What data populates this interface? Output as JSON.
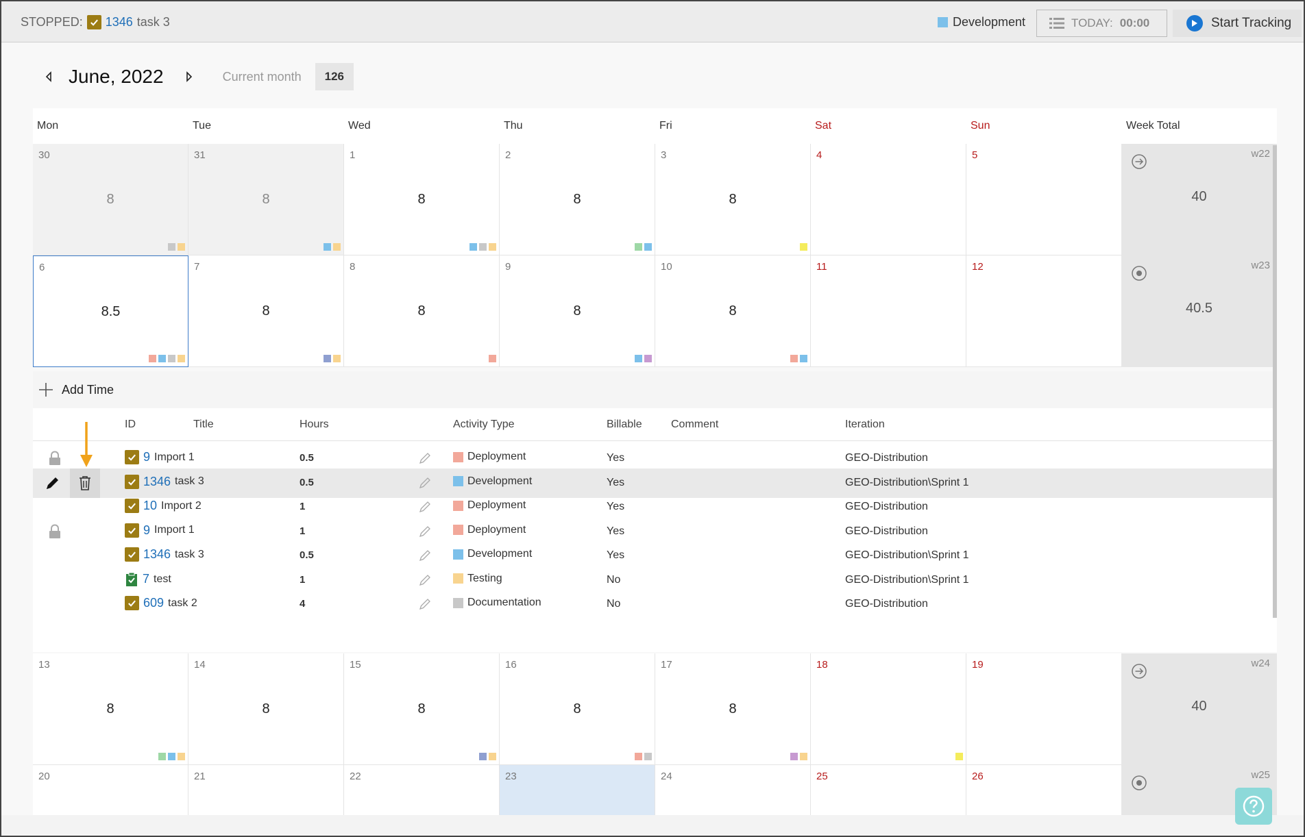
{
  "topbar": {
    "status_label": "STOPPED:",
    "task_id": "1346",
    "task_title": "task 3",
    "activity": "Development",
    "activity_color": "#7cc0ea",
    "today_label": "TODAY:",
    "today_time": "00:00",
    "start_label": "Start Tracking"
  },
  "month": {
    "title": "June, 2022",
    "current_label": "Current month",
    "total": "126"
  },
  "dow": [
    "Mon",
    "Tue",
    "Wed",
    "Thu",
    "Fri",
    "Sat",
    "Sun",
    "Week Total"
  ],
  "weeks": [
    {
      "week": "w22",
      "total": "40",
      "icon": "arrow-circle-icon",
      "days": [
        {
          "n": "30",
          "h": "8",
          "gray": true,
          "colors": [
            "#c8c8c8",
            "#f8d48f"
          ]
        },
        {
          "n": "31",
          "h": "8",
          "gray": true,
          "colors": [
            "#7cc0ea",
            "#f8d48f"
          ]
        },
        {
          "n": "1",
          "h": "8",
          "colors": [
            "#7cc0ea",
            "#c8c8c8",
            "#f8d48f"
          ]
        },
        {
          "n": "2",
          "h": "8",
          "colors": [
            "#9ed8a6",
            "#7cc0ea"
          ]
        },
        {
          "n": "3",
          "h": "8",
          "colors": [
            "#f4ec5c"
          ]
        },
        {
          "n": "4",
          "h": "",
          "colors": []
        },
        {
          "n": "5",
          "h": "",
          "colors": []
        }
      ]
    },
    {
      "week": "w23",
      "total": "40.5",
      "icon": "target-circle-icon",
      "days": [
        {
          "n": "6",
          "h": "8.5",
          "sel": true,
          "colors": [
            "#f2a89a",
            "#7cc0ea",
            "#c8c8c8",
            "#f8d48f"
          ]
        },
        {
          "n": "7",
          "h": "8",
          "colors": [
            "#8f9fd0",
            "#f8d48f"
          ]
        },
        {
          "n": "8",
          "h": "8",
          "colors": [
            "#f2a89a"
          ]
        },
        {
          "n": "9",
          "h": "8",
          "colors": [
            "#7cc0ea",
            "#c79ad1"
          ]
        },
        {
          "n": "10",
          "h": "8",
          "colors": [
            "#f2a89a",
            "#7cc0ea"
          ]
        },
        {
          "n": "11",
          "h": "",
          "colors": []
        },
        {
          "n": "12",
          "h": "",
          "colors": []
        }
      ]
    },
    {
      "week": "w24",
      "total": "40",
      "icon": "arrow-circle-icon",
      "days": [
        {
          "n": "13",
          "h": "8",
          "colors": [
            "#9ed8a6",
            "#7cc0ea",
            "#f8d48f"
          ]
        },
        {
          "n": "14",
          "h": "8",
          "colors": []
        },
        {
          "n": "15",
          "h": "8",
          "colors": [
            "#8f9fd0",
            "#f8d48f"
          ]
        },
        {
          "n": "16",
          "h": "8",
          "colors": [
            "#f2a89a",
            "#c8c8c8"
          ]
        },
        {
          "n": "17",
          "h": "8",
          "colors": [
            "#c79ad1",
            "#f8d48f"
          ]
        },
        {
          "n": "18",
          "h": "",
          "colors": [
            "#f4ec5c"
          ]
        },
        {
          "n": "19",
          "h": "",
          "colors": []
        }
      ]
    },
    {
      "week": "w25",
      "total": "",
      "icon": "target-circle-icon",
      "days": [
        {
          "n": "20",
          "h": "",
          "colors": []
        },
        {
          "n": "21",
          "h": "",
          "colors": []
        },
        {
          "n": "22",
          "h": "",
          "colors": []
        },
        {
          "n": "23",
          "h": "",
          "today": true,
          "colors": []
        },
        {
          "n": "24",
          "h": "",
          "colors": []
        },
        {
          "n": "25",
          "h": "",
          "colors": []
        },
        {
          "n": "26",
          "h": "",
          "colors": []
        }
      ]
    }
  ],
  "details": {
    "add_label": "Add Time",
    "columns": [
      "ID",
      "Title",
      "Hours",
      "Activity Type",
      "Billable",
      "Comment",
      "Iteration"
    ],
    "rows": [
      {
        "lock": true,
        "icon": "check",
        "id": "9",
        "title": "Import 1",
        "hours": "0.5",
        "activity": "Deployment",
        "color": "#f2a89a",
        "billable": "Yes",
        "iteration": "GEO-Distribution"
      },
      {
        "hl": true,
        "icon": "check",
        "id": "1346",
        "title": "task 3",
        "hours": "0.5",
        "activity": "Development",
        "color": "#7cc0ea",
        "billable": "Yes",
        "iteration": "GEO-Distribution\\Sprint 1"
      },
      {
        "icon": "check",
        "id": "10",
        "title": "Import 2",
        "hours": "1",
        "activity": "Deployment",
        "color": "#f2a89a",
        "billable": "Yes",
        "iteration": "GEO-Distribution"
      },
      {
        "lock": true,
        "icon": "check",
        "id": "9",
        "title": "Import 1",
        "hours": "1",
        "activity": "Deployment",
        "color": "#f2a89a",
        "billable": "Yes",
        "iteration": "GEO-Distribution"
      },
      {
        "icon": "check",
        "id": "1346",
        "title": "task 3",
        "hours": "0.5",
        "activity": "Development",
        "color": "#7cc0ea",
        "billable": "Yes",
        "iteration": "GEO-Distribution\\Sprint 1"
      },
      {
        "icon": "test",
        "id": "7",
        "title": "test",
        "hours": "1",
        "activity": "Testing",
        "color": "#f8d48f",
        "billable": "No",
        "iteration": "GEO-Distribution\\Sprint 1"
      },
      {
        "icon": "check",
        "id": "609",
        "title": "task 2",
        "hours": "4",
        "activity": "Documentation",
        "color": "#c8c8c8",
        "billable": "No",
        "iteration": "GEO-Distribution"
      }
    ]
  }
}
